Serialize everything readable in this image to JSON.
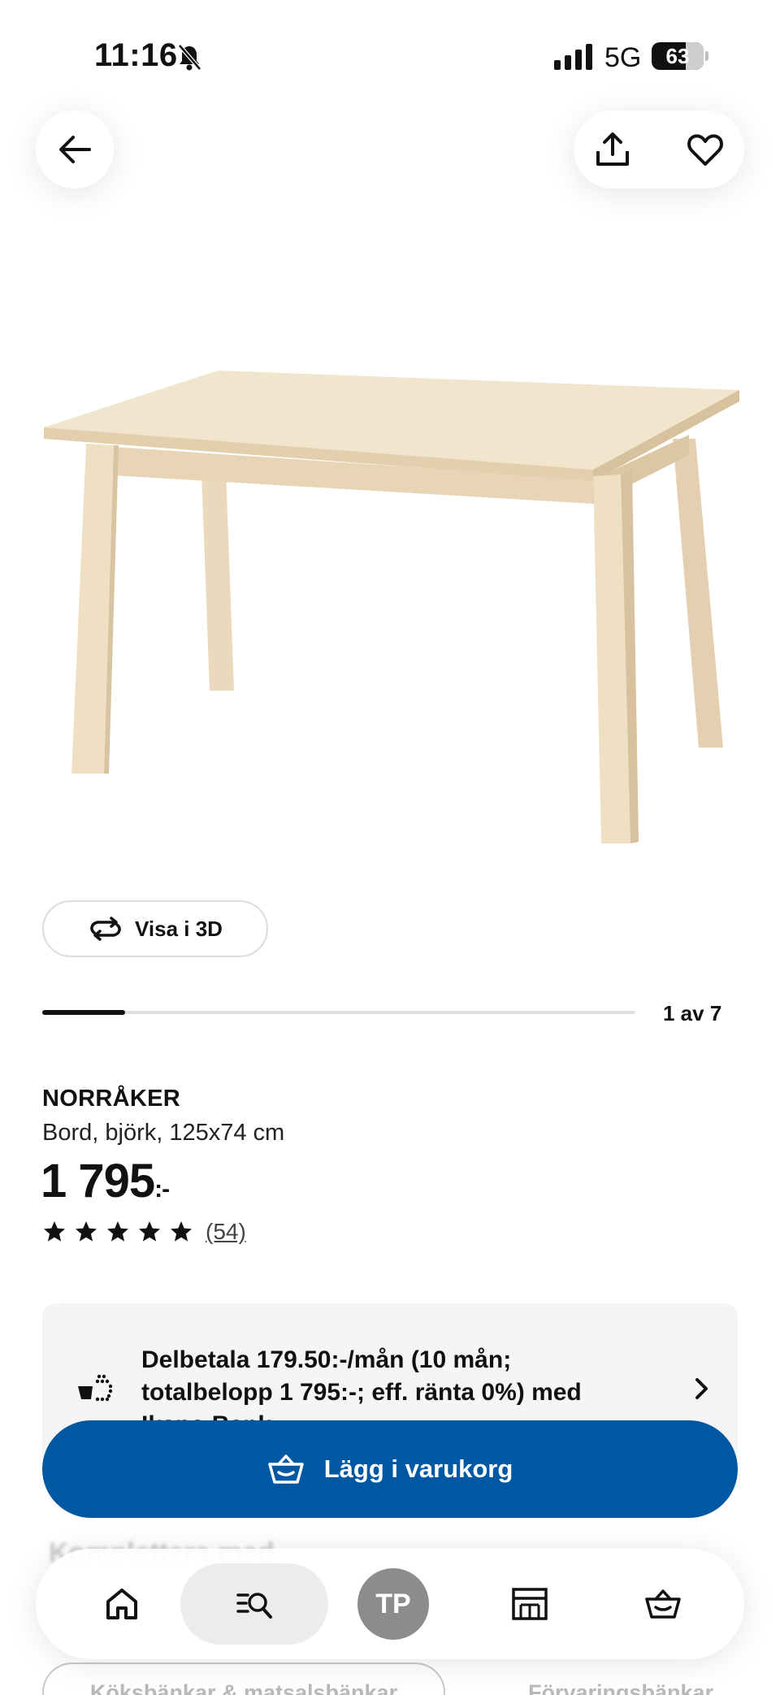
{
  "status_bar": {
    "time": "11:16",
    "network": "5G",
    "battery": "63"
  },
  "product": {
    "view_3d_label": "Visa i 3D",
    "gallery_counter": "1 av 7",
    "gallery_progress": 0.14,
    "name": "NORRÅKER",
    "description": "Bord, björk, 125x74 cm",
    "price": "1 795",
    "price_suffix": ":-",
    "rating": 5,
    "review_count": "(54)"
  },
  "financing": {
    "text": "Delbetala 179.50:-/mån (10 mån; totalbelopp 1 795:-; eff. ränta 0%) med Ikano Bank"
  },
  "cart": {
    "button_label": "Lägg i varukorg"
  },
  "related": {
    "heading": "Komplettera med",
    "chips": [
      "Köksbänkar & matsalsbänkar",
      "Förvaringsbänkar"
    ]
  },
  "nav": {
    "profile_initials": "TP"
  },
  "icons": {
    "back": "arrow-left-icon",
    "share": "share-icon",
    "favorite": "heart-icon",
    "rotate": "rotate-3d-icon",
    "finance": "basket-dots-icon",
    "cart": "shopping-basket-icon",
    "home": "home-icon",
    "search": "search-list-icon",
    "store": "store-icon"
  },
  "colors": {
    "primary_button": "#0058a3",
    "card_background": "#f5f5f5",
    "avatar": "#8c8c8c"
  }
}
